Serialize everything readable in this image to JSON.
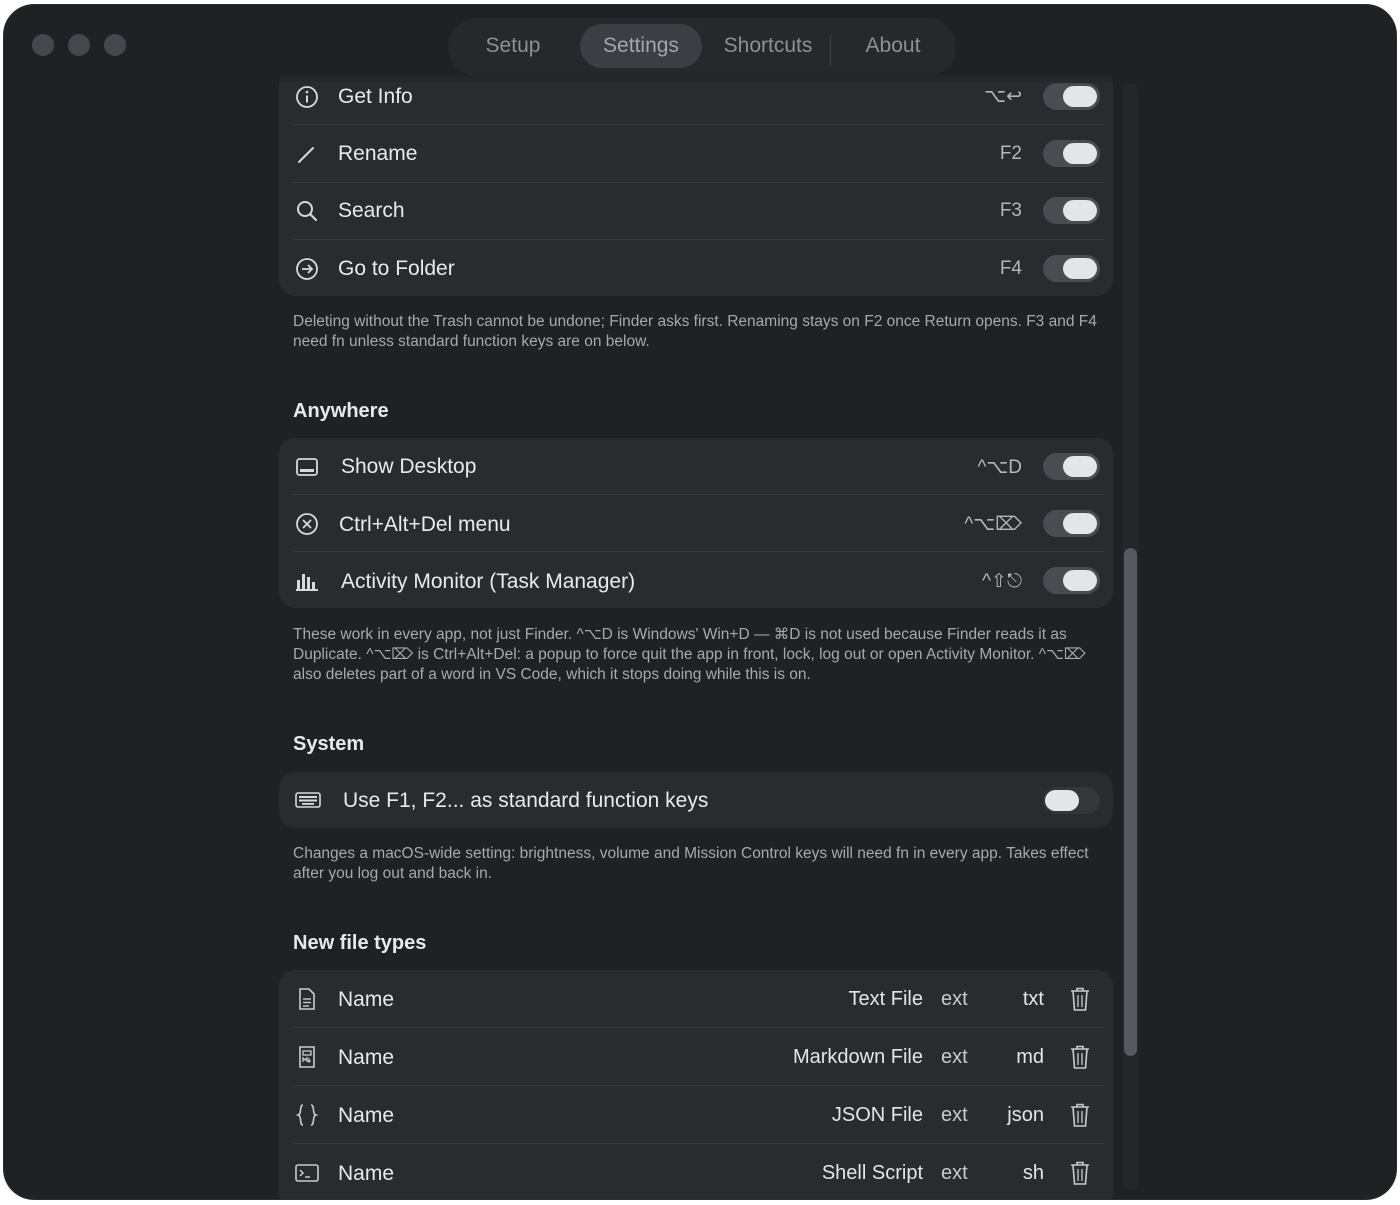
{
  "window": {
    "tabs": [
      {
        "label": "Setup",
        "active": false
      },
      {
        "label": "Settings",
        "active": true
      },
      {
        "label": "Shortcuts",
        "active": false
      },
      {
        "label": "About",
        "active": false
      }
    ]
  },
  "finder": {
    "rows": [
      {
        "label": "Get Info",
        "shortcut": "⌥↩",
        "icon": "info-icon",
        "enabled": true
      },
      {
        "label": "Rename",
        "shortcut": "F2",
        "icon": "pencil-icon",
        "enabled": true
      },
      {
        "label": "Search",
        "shortcut": "F3",
        "icon": "search-icon",
        "enabled": true
      },
      {
        "label": "Go to Folder",
        "shortcut": "F4",
        "icon": "go-arrow-icon",
        "enabled": true
      }
    ],
    "note": "Deleting without the Trash cannot be undone; Finder asks first. Renaming stays on F2 once Return opens. F3 and F4 need fn unless standard function keys are on below."
  },
  "anywhere": {
    "title": "Anywhere",
    "rows": [
      {
        "label": "Show Desktop",
        "shortcut": "^⌥D",
        "icon": "desktop-icon",
        "enabled": true
      },
      {
        "label": "Ctrl+Alt+Del menu",
        "shortcut": "^⌥⌦",
        "icon": "xmark-circle-icon",
        "enabled": true
      },
      {
        "label": "Activity Monitor (Task Manager)",
        "shortcut": "^⇧⎋",
        "icon": "chart-bars-icon",
        "enabled": true
      }
    ],
    "note": "These work in every app, not just Finder. ^⌥D is Windows' Win+D — ⌘D is not used because Finder reads it as Duplicate. ^⌥⌦ is Ctrl+Alt+Del: a popup to force quit the app in front, lock, log out or open Activity Monitor. ^⌥⌦ also deletes part of a word in VS Code, which it stops doing while this is on."
  },
  "system": {
    "title": "System",
    "rows": [
      {
        "label": "Use F1, F2... as standard function keys",
        "icon": "keyboard-icon",
        "enabled": false
      }
    ],
    "note": "Changes a macOS-wide setting: brightness, volume and Mission Control keys will need fn in every app. Takes effect after you log out and back in."
  },
  "file_types": {
    "title": "New file types",
    "name_label": "Name",
    "ext_label": "ext",
    "rows": [
      {
        "kind": "Text File",
        "ext": "txt",
        "icon": "document-icon"
      },
      {
        "kind": "Markdown File",
        "ext": "md",
        "icon": "markdown-doc-icon"
      },
      {
        "kind": "JSON File",
        "ext": "json",
        "icon": "curly-braces-icon"
      },
      {
        "kind": "Shell Script",
        "ext": "sh",
        "icon": "terminal-icon"
      }
    ]
  }
}
